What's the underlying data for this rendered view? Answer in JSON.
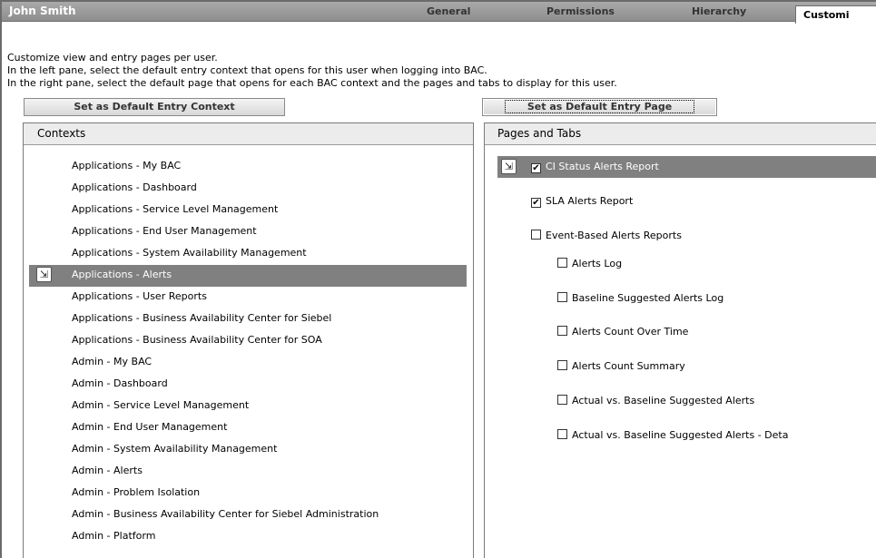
{
  "header": {
    "user_name": "John Smith",
    "tabs": [
      {
        "label": "General"
      },
      {
        "label": "Permissions"
      },
      {
        "label": "Hierarchy"
      },
      {
        "label": "Customi",
        "active": true
      }
    ]
  },
  "instructions": [
    "Customize view and entry pages per user.",
    "In the left pane, select the default entry context that opens for this user when logging into BAC.",
    "In the right pane, select the default page that opens for each BAC context and the pages and tabs to display for this user."
  ],
  "buttons": {
    "set_default_context": "Set as Default Entry Context",
    "set_default_page": "Set as Default Entry Page"
  },
  "contexts": {
    "title": "Contexts",
    "selected_index": 5,
    "items": [
      "Applications - My BAC",
      "Applications - Dashboard",
      "Applications - Service Level Management",
      "Applications - End User Management",
      "Applications - System Availability Management",
      "Applications - Alerts",
      "Applications - User Reports",
      "Applications - Business Availability Center for Siebel",
      "Applications - Business Availability Center for SOA",
      "Admin - My BAC",
      "Admin - Dashboard",
      "Admin - Service Level Management",
      "Admin - End User Management",
      "Admin - System Availability Management",
      "Admin - Alerts",
      "Admin - Problem Isolation",
      "Admin - Business Availability Center for Siebel Administration",
      "Admin - Platform"
    ]
  },
  "pages": {
    "title": "Pages and Tabs",
    "items": [
      {
        "label": "CI Status Alerts Report",
        "checked": true,
        "level": 0,
        "selected": true
      },
      {
        "label": "SLA Alerts Report",
        "checked": true,
        "level": 0
      },
      {
        "label": "Event-Based Alerts Reports",
        "checked": false,
        "level": 0
      },
      {
        "label": "Alerts Log",
        "checked": false,
        "level": 1
      },
      {
        "label": "Baseline Suggested Alerts Log",
        "checked": false,
        "level": 1
      },
      {
        "label": "Alerts Count Over Time",
        "checked": false,
        "level": 1
      },
      {
        "label": "Alerts Count Summary",
        "checked": false,
        "level": 1
      },
      {
        "label": "Actual vs. Baseline Suggested Alerts",
        "checked": false,
        "level": 1
      },
      {
        "label": "Actual vs. Baseline Suggested Alerts - Deta",
        "checked": false,
        "level": 1
      }
    ]
  },
  "icons": {
    "entry_page_icon": "default-entry-icon",
    "checkbox_checked": "checkbox-checked-icon",
    "checkbox_unchecked": "checkbox-unchecked-icon"
  }
}
